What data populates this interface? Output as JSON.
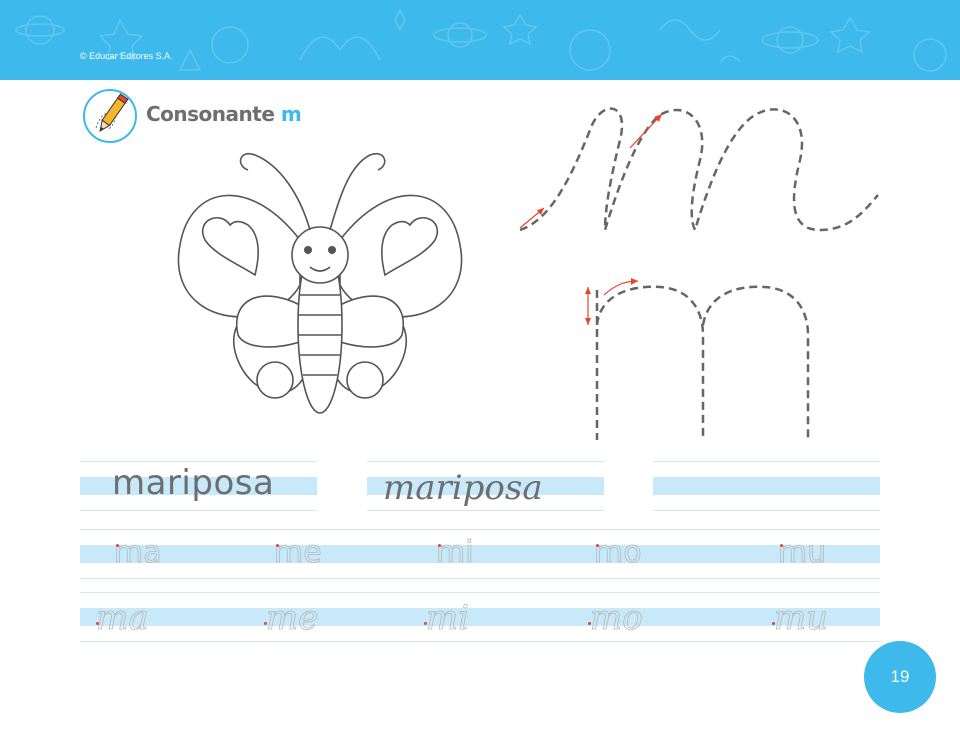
{
  "header": {
    "copyright": "© Educar Editores S.A.",
    "title_prefix": "Consonante",
    "title_letter": "m",
    "icon": "pencil-icon"
  },
  "word": {
    "print": "mariposa",
    "cursive": "mariposa"
  },
  "syllables_print": [
    "ma",
    "me",
    "mi",
    "mo",
    "mu"
  ],
  "syllables_cursive": [
    "ma",
    "me",
    "mi",
    "mo",
    "mu"
  ],
  "page_number": "19",
  "colors": {
    "accent": "#3db9eb",
    "band": "#c7e9fa",
    "arrow": "#e8452c",
    "text_gray": "#6d6e71"
  }
}
